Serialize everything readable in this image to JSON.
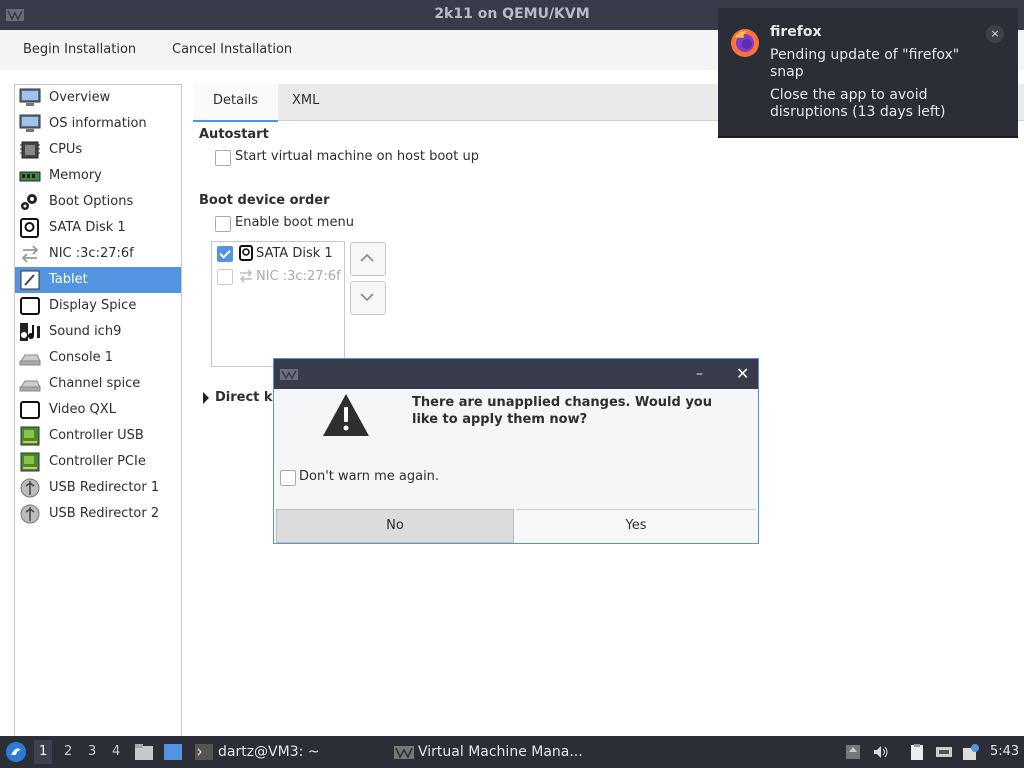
{
  "window": {
    "title": "2k11 on QEMU/KVM"
  },
  "menubar": {
    "begin_installation": "Begin Installation",
    "cancel_installation": "Cancel Installation"
  },
  "sidebar": {
    "items": [
      {
        "label": "Overview",
        "icon": "monitor-icon"
      },
      {
        "label": "OS information",
        "icon": "monitor-icon"
      },
      {
        "label": "CPUs",
        "icon": "cpu-icon"
      },
      {
        "label": "Memory",
        "icon": "memory-icon"
      },
      {
        "label": "Boot Options",
        "icon": "gear-icon"
      },
      {
        "label": "SATA Disk 1",
        "icon": "disk-icon"
      },
      {
        "label": "NIC :3c:27:6f",
        "icon": "network-arrows-icon"
      },
      {
        "label": "Tablet",
        "icon": "tablet-icon",
        "selected": true
      },
      {
        "label": "Display Spice",
        "icon": "display-icon"
      },
      {
        "label": "Sound ich9",
        "icon": "sound-icon"
      },
      {
        "label": "Console 1",
        "icon": "console-icon"
      },
      {
        "label": "Channel spice",
        "icon": "channel-icon"
      },
      {
        "label": "Video QXL",
        "icon": "video-icon"
      },
      {
        "label": "Controller USB",
        "icon": "controller-icon"
      },
      {
        "label": "Controller PCIe",
        "icon": "controller-icon"
      },
      {
        "label": "USB Redirector 1",
        "icon": "usb-icon"
      },
      {
        "label": "USB Redirector 2",
        "icon": "usb-icon"
      }
    ]
  },
  "tabs": {
    "details": "Details",
    "xml": "XML"
  },
  "autostart": {
    "title": "Autostart",
    "checkbox_label": "Start virtual machine on host boot up",
    "checked": false
  },
  "boot": {
    "title": "Boot device order",
    "enable_menu_label": "Enable boot menu",
    "enable_menu_checked": false,
    "devices": [
      {
        "label": "SATA Disk 1",
        "checked": true
      },
      {
        "label": "NIC :3c:27:6f",
        "checked": false
      }
    ]
  },
  "direct": {
    "label": "Direct k"
  },
  "notification": {
    "app": "firefox",
    "body1": "Pending update of \"firefox\" snap",
    "body2": "Close the app to avoid disruptions (13 days left)",
    "close": "×"
  },
  "dialog": {
    "message": "There are unapplied changes. Would you like to apply them now?",
    "dont_warn": "Don't warn me again.",
    "no": "No",
    "yes": "Yes",
    "minimize": "–",
    "close": "✕"
  },
  "taskbar": {
    "workspaces": [
      "1",
      "2",
      "3",
      "4"
    ],
    "terminal_task": "dartz@VM3: ~",
    "vmm_task": "Virtual Machine Mana...",
    "time": "5:43"
  },
  "colors": {
    "accent": "#5294e2",
    "titlebar": "#383c4a",
    "panel": "#2b2e37"
  }
}
